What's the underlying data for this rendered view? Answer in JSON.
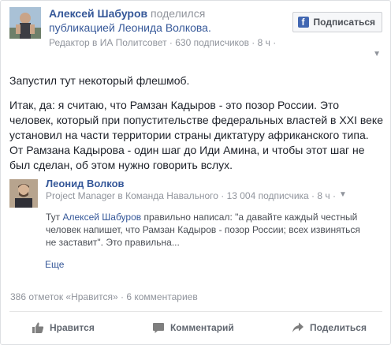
{
  "header": {
    "author": "Алексей Шабуров",
    "shared_text": "поделился",
    "shared_object": "публикацией Леонида Волкова.",
    "meta": "Редактор в ИА Политсовет · 630 подписчиков · 8 ч ·",
    "subscribe_label": "Подписаться",
    "subscribe_icon": "facebook-icon"
  },
  "post": {
    "paragraphs": [
      "Запустил тут некоторый флешмоб.",
      "Итак, да: я считаю, что Рамзан Кадыров - это позор России. Это человек, который при попустительстве федеральных властей в XXI веке установил на части территории страны диктатуру африканского типа. От Рамзана Кадырова - один шаг до Иди Амина, и чтобы этот шаг не был сделан, об этом нужно говорить вслух."
    ]
  },
  "quoted": {
    "name": "Леонид Волков",
    "meta": "Project Manager в Команда Навального · 13 004 подписчика · 8 ч ·",
    "text_prefix": "Тут ",
    "text_link": "Алексей Шабуров",
    "text_rest": " правильно написал: \"а давайте каждый честный человек напишет, что Рамзан Кадыров - позор России; всех извиняться не заставит\". Это правильна...",
    "more_label": "Еще"
  },
  "stats": {
    "text": "386 отметок «Нравится» · 6 комментариев"
  },
  "actions": {
    "like": "Нравится",
    "comment": "Комментарий",
    "share": "Поделиться"
  },
  "colors": {
    "link": "#365899",
    "meta": "#90949c",
    "fb_blue": "#4267b2"
  }
}
